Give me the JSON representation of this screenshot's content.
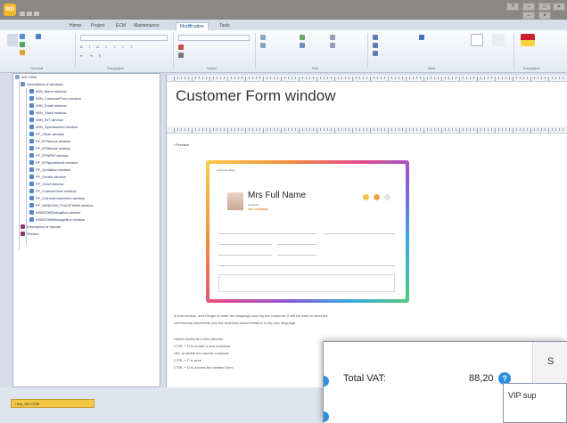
{
  "window": {
    "app_logo": "WD",
    "title": "",
    "controls": [
      "–",
      "□",
      "×",
      "?",
      "–",
      "×"
    ]
  },
  "ribbon": {
    "tabs": [
      "Home",
      "Project",
      "ECM",
      "Maintenance",
      "Modification",
      "Tools"
    ],
    "active_tab_index": 4,
    "groups": [
      "General",
      "Paragraph",
      "Styles",
      "Edit",
      "Help",
      "Translation"
    ]
  },
  "tree": {
    "root": "WD CRM",
    "items": [
      "Description of windows",
      "WIN_Menu window",
      "WIN_CustomerForm window",
      "WIN_Email window",
      "WIN_Stock window",
      "WIN_INT window",
      "WIN_Spreadsheet window",
      "PF_Other window",
      "PF_BTNstock window",
      "PF_BTNblock window",
      "PF_BTNPAT window",
      "PF_BTNprodstock window",
      "PF_Quotation window",
      "PF_Emails window",
      "PF_Chart window",
      "PF_CustomChart window",
      "PF_ColumnCustomers window",
      "PF_WINDOW_PLACETable window",
      "WINDOWDialogBox window",
      "WINDOWMessageBox window",
      "Description of reports",
      "Section"
    ]
  },
  "document": {
    "title": "Customer Form window",
    "bullet": "Preview",
    "paragraphs": [
      "In this window, don't forget to enter the language used by the customer. It will be used to send the",
      "commercial documents and the technical documentation in his own language.",
      "",
      "Useful shortcuts in this window:",
      "CTRL + N to create a new customer",
      "DEL to delete the current customer",
      "CTRL + P to print",
      "CTRL + D to access the detailed form"
    ]
  },
  "preview": {
    "brand": "Customer Base",
    "name": "Mrs Full Name",
    "company": "Company",
    "vip": "VIP CUSTOMER",
    "colors": {
      "gradient": [
        "#f7d04c",
        "#f08b3d",
        "#e24a8a",
        "#8a5cd6",
        "#3aa8e0",
        "#55c97a"
      ]
    }
  },
  "popup": {
    "total_vat_label": "Total VAT:",
    "total_vat_value": "88,20",
    "help_glyph": "?",
    "right_header": "S",
    "vip_label": "VIP sup"
  },
  "status": {
    "doc_tab": "Help_WD CRM"
  },
  "colors": {
    "titlebar": "#8a8784",
    "accent": "#2d8fe0",
    "doc_tab": "#f3c846"
  }
}
